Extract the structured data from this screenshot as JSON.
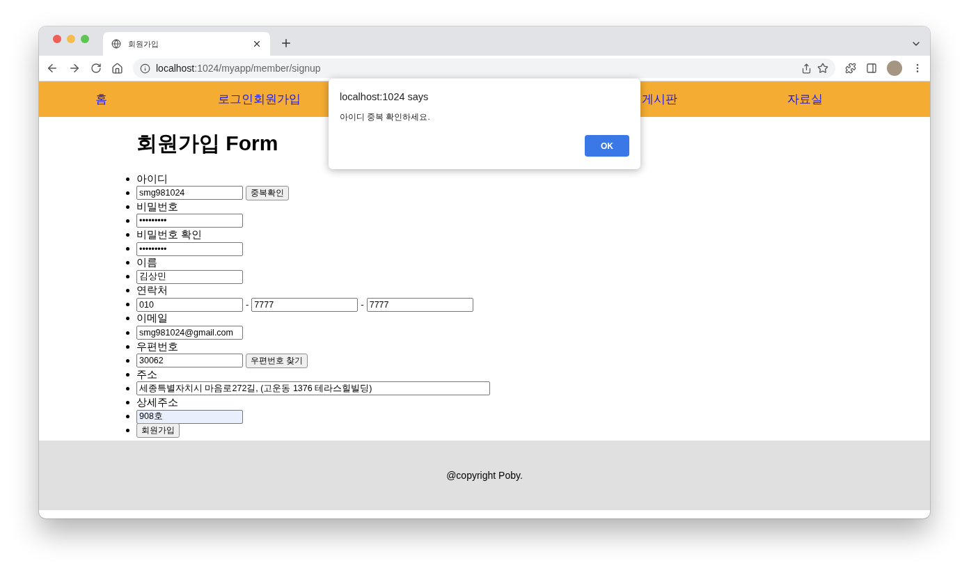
{
  "browser": {
    "tab": {
      "title": "회원가입",
      "selected": true
    },
    "url": {
      "host": "localhost",
      "path": ":1024/myapp/member/signup"
    }
  },
  "nav": [
    {
      "label": "홈"
    },
    {
      "label": "로그인회원가입"
    },
    {
      "label": "게시판"
    },
    {
      "label": "자료실"
    }
  ],
  "form": {
    "title": "회원가입 Form",
    "rows": [
      {
        "kind": "label",
        "text": "아이디"
      },
      {
        "kind": "fields",
        "items": [
          {
            "kind": "input",
            "value": "smg981024",
            "autofilled": false
          },
          {
            "kind": "button",
            "text": "중복확인"
          }
        ]
      },
      {
        "kind": "label",
        "text": "비밀번호"
      },
      {
        "kind": "fields",
        "items": [
          {
            "kind": "input",
            "value": "•••••••••",
            "autofilled": false
          }
        ]
      },
      {
        "kind": "label",
        "text": "비밀번호 확인"
      },
      {
        "kind": "fields",
        "items": [
          {
            "kind": "input",
            "value": "•••••••••",
            "autofilled": false
          }
        ]
      },
      {
        "kind": "label",
        "text": "이름"
      },
      {
        "kind": "fields",
        "items": [
          {
            "kind": "input",
            "value": "김상민",
            "autofilled": false
          }
        ]
      },
      {
        "kind": "label",
        "text": "연락처"
      },
      {
        "kind": "fields",
        "items": [
          {
            "kind": "input",
            "value": "010",
            "autofilled": false
          },
          {
            "kind": "separator",
            "text": "-"
          },
          {
            "kind": "input",
            "value": "7777",
            "autofilled": false
          },
          {
            "kind": "separator",
            "text": "-"
          },
          {
            "kind": "input",
            "value": "7777",
            "autofilled": false
          }
        ]
      },
      {
        "kind": "label",
        "text": "이메일"
      },
      {
        "kind": "fields",
        "items": [
          {
            "kind": "input",
            "value": "smg981024@gmail.com",
            "autofilled": false
          }
        ]
      },
      {
        "kind": "label",
        "text": "우편번호"
      },
      {
        "kind": "fields",
        "items": [
          {
            "kind": "input",
            "value": "30062",
            "autofilled": false
          },
          {
            "kind": "button",
            "text": "우편번호 찾기"
          }
        ]
      },
      {
        "kind": "label",
        "text": "주소"
      },
      {
        "kind": "fields",
        "items": [
          {
            "kind": "wide-input",
            "value": "세종특별자치시 마음로272길, (고운동 1376 테라스힐빌딩)",
            "autofilled": false
          }
        ]
      },
      {
        "kind": "label",
        "text": "상세주소"
      },
      {
        "kind": "fields",
        "items": [
          {
            "kind": "input",
            "value": "908호",
            "autofilled": true
          }
        ]
      },
      {
        "kind": "fields",
        "items": [
          {
            "kind": "button",
            "text": "회원가입"
          }
        ]
      }
    ]
  },
  "footer": {
    "text": "@copyright Poby."
  },
  "dialog": {
    "title": "localhost:1024 says",
    "message": "아이디 중복 확인하세요.",
    "button": "OK"
  }
}
